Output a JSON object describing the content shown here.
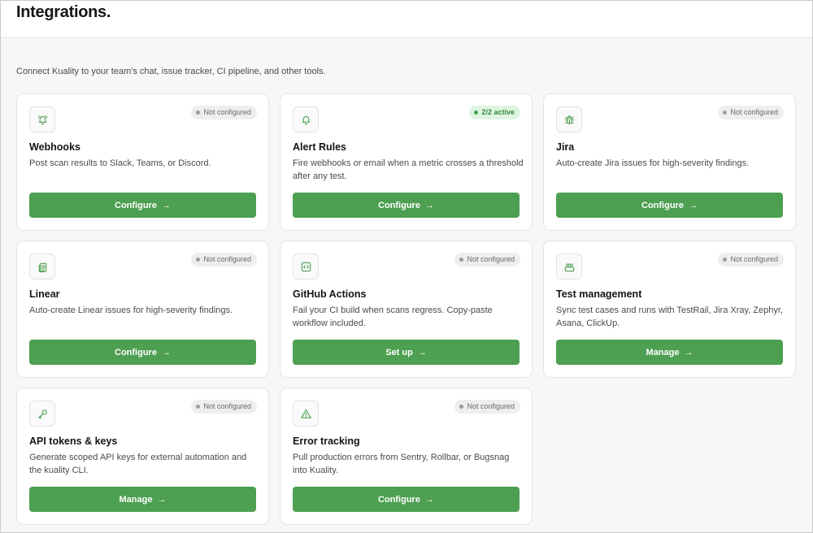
{
  "header": {
    "title": "Integrations."
  },
  "subtitle": "Connect Kuality to your team's chat, issue tracker, CI pipeline, and other tools.",
  "colors": {
    "accent": "#4d9f51",
    "icon": "#4d9f51",
    "active_badge_bg": "#dff5e2"
  },
  "cards": [
    {
      "icon": "webhook-bell-icon",
      "badge": "Not configured",
      "badge_state": "inactive",
      "title": "Webhooks",
      "description": "Post scan results to Slack, Teams, or Discord.",
      "button": "Configure",
      "arrow": "→"
    },
    {
      "icon": "bell-icon",
      "badge": "2/2 active",
      "badge_state": "active",
      "title": "Alert Rules",
      "description": "Fire webhooks or email when a metric crosses a threshold after any test.",
      "button": "Configure",
      "arrow": "→"
    },
    {
      "icon": "bug-icon",
      "badge": "Not configured",
      "badge_state": "inactive",
      "title": "Jira",
      "description": "Auto-create Jira issues for high-severity findings.",
      "button": "Configure",
      "arrow": "→"
    },
    {
      "icon": "clipboard-icon",
      "badge": "Not configured",
      "badge_state": "inactive",
      "title": "Linear",
      "description": "Auto-create Linear issues for high-severity findings.",
      "button": "Configure",
      "arrow": "→"
    },
    {
      "icon": "code-icon",
      "badge": "Not configured",
      "badge_state": "inactive",
      "title": "GitHub Actions",
      "description": "Fail your CI build when scans regress. Copy-paste workflow included.",
      "button": "Set up",
      "arrow": "→"
    },
    {
      "icon": "archive-icon",
      "badge": "Not configured",
      "badge_state": "inactive",
      "title": "Test management",
      "description": "Sync test cases and runs with TestRail, Jira Xray, Zephyr, Asana, ClickUp.",
      "button": "Manage",
      "arrow": "→"
    },
    {
      "icon": "key-icon",
      "badge": "Not configured",
      "badge_state": "inactive",
      "title": "API tokens & keys",
      "description": "Generate scoped API keys for external automation and the kuality CLI.",
      "button": "Manage",
      "arrow": "→"
    },
    {
      "icon": "warning-icon",
      "badge": "Not configured",
      "badge_state": "inactive",
      "title": "Error tracking",
      "description": "Pull production errors from Sentry, Rollbar, or Bugsnag into Kuality.",
      "button": "Configure",
      "arrow": "→"
    }
  ]
}
